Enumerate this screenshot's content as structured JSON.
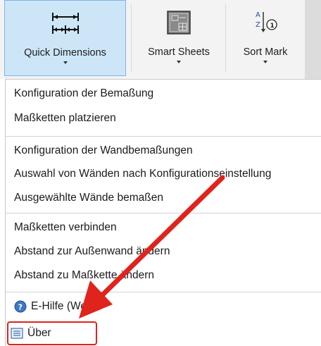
{
  "ribbon": {
    "buttons": [
      {
        "label": "Quick Dimensions",
        "icon": "dimension-icon",
        "active": true
      },
      {
        "label": "Smart Sheets",
        "icon": "sheet-icon"
      },
      {
        "label": "Sort Mark",
        "icon": "sort-mark-icon"
      }
    ]
  },
  "menu": {
    "items": [
      {
        "label": "Konfiguration der Bemaßung"
      },
      {
        "label": "Maßketten platzieren"
      },
      {
        "label": "Konfiguration der Wandbemaßungen"
      },
      {
        "label": "Auswahl von Wänden nach Konfigurationseinstellung"
      },
      {
        "label": "Ausgewählte Wände bemaßen"
      },
      {
        "label": "Maßketten verbinden"
      },
      {
        "label": "Abstand zur Außenwand ändern"
      },
      {
        "label": "Abstand zu Maßkette ändern"
      },
      {
        "label": "E-Hilfe (Web)",
        "icon": "help-icon"
      },
      {
        "label": "Über",
        "icon": "about-list-icon",
        "highlighted": true
      }
    ]
  },
  "colors": {
    "active_button_bg": "#cde6f7",
    "active_button_border": "#7eb4ea",
    "annotation": "#e0231c"
  }
}
